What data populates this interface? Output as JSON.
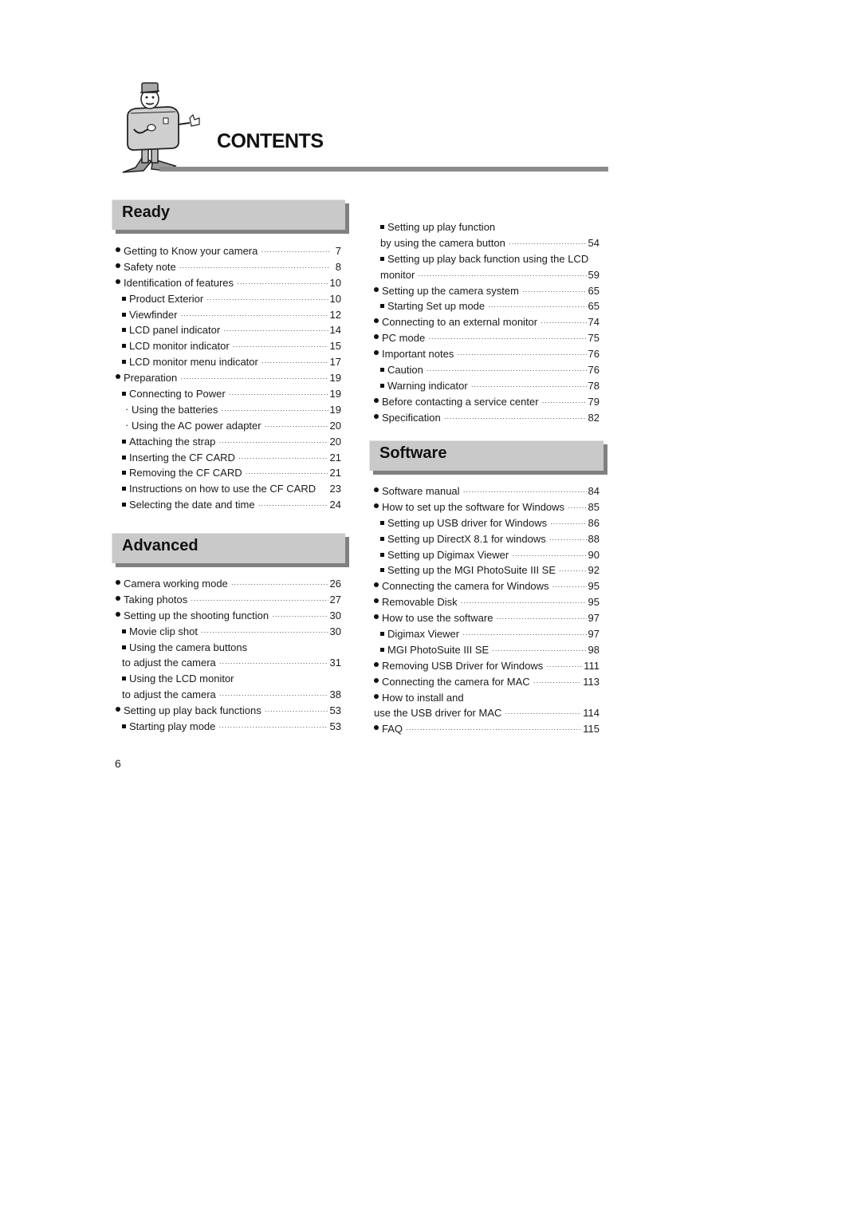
{
  "header": {
    "title": "CONTENTS",
    "mascot_icon": "camera-mascot-icon"
  },
  "sections": {
    "ready": {
      "label": "Ready",
      "items": [
        {
          "level": 0,
          "text": "Getting to Know your camera",
          "page": "7"
        },
        {
          "level": 0,
          "text": "Safety note",
          "page": "8"
        },
        {
          "level": 0,
          "text": "Identification of features",
          "page": "10"
        },
        {
          "level": 1,
          "text": "Product Exterior",
          "page": "10"
        },
        {
          "level": 1,
          "text": "Viewfinder",
          "page": "12"
        },
        {
          "level": 1,
          "text": "LCD panel indicator",
          "page": "14"
        },
        {
          "level": 1,
          "text": "LCD monitor indicator",
          "page": "15"
        },
        {
          "level": 1,
          "text": "LCD monitor menu indicator",
          "page": "17"
        },
        {
          "level": 0,
          "text": "Preparation",
          "page": "19"
        },
        {
          "level": 1,
          "text": "Connecting to Power",
          "page": "19"
        },
        {
          "level": 2,
          "text": "Using the batteries",
          "page": "19"
        },
        {
          "level": 2,
          "text": "Using the AC power adapter",
          "page": "20"
        },
        {
          "level": 1,
          "text": "Attaching the strap",
          "page": "20"
        },
        {
          "level": 1,
          "text": "Inserting the CF CARD",
          "page": "21"
        },
        {
          "level": 1,
          "text": "Removing the CF CARD",
          "page": "21"
        },
        {
          "level": 1,
          "text": "Instructions on how to use the CF CARD",
          "page": "23",
          "nodots": true
        },
        {
          "level": 1,
          "text": "Selecting the date and time",
          "page": "24"
        }
      ]
    },
    "advanced": {
      "label": "Advanced",
      "items": [
        {
          "level": 0,
          "text": "Camera working mode",
          "page": "26"
        },
        {
          "level": 0,
          "text": "Taking photos",
          "page": "27"
        },
        {
          "level": 0,
          "text": "Setting up the shooting function",
          "page": "30"
        },
        {
          "level": 1,
          "text": "Movie clip shot",
          "page": "30"
        },
        {
          "level": 1,
          "text": "Using the camera buttons",
          "page": "",
          "nodots": true
        },
        {
          "level": "cont",
          "text": "to adjust the camera",
          "page": "31"
        },
        {
          "level": 1,
          "text": "Using the LCD monitor",
          "page": "",
          "nodots": true
        },
        {
          "level": "cont",
          "text": "to adjust the camera",
          "page": "38"
        },
        {
          "level": 0,
          "text": "Setting up play back functions",
          "page": "53"
        },
        {
          "level": 1,
          "text": "Starting play mode",
          "page": "53"
        }
      ]
    },
    "ready_continued": {
      "items": [
        {
          "level": 1,
          "text": "Setting up play function",
          "page": "",
          "nodots": true
        },
        {
          "level": "cont",
          "text": "by using the camera button",
          "page": "54"
        },
        {
          "level": 1,
          "text": "Setting up play back function using the LCD",
          "page": "",
          "nodots": true
        },
        {
          "level": "cont",
          "text": "monitor",
          "page": "59"
        },
        {
          "level": 0,
          "text": "Setting up the camera system",
          "page": "65"
        },
        {
          "level": 1,
          "text": "Starting Set up mode",
          "page": "65"
        },
        {
          "level": 0,
          "text": "Connecting to an external monitor",
          "page": "74"
        },
        {
          "level": 0,
          "text": "PC mode",
          "page": "75"
        },
        {
          "level": 0,
          "text": "Important notes",
          "page": "76"
        },
        {
          "level": 1,
          "text": "Caution",
          "page": "76"
        },
        {
          "level": 1,
          "text": "Warning indicator",
          "page": "78"
        },
        {
          "level": 0,
          "text": "Before contacting a service center",
          "page": "79"
        },
        {
          "level": 0,
          "text": "Specification",
          "page": "82"
        }
      ]
    },
    "software": {
      "label": "Software",
      "items": [
        {
          "level": 0,
          "text": "Software manual",
          "page": "84"
        },
        {
          "level": 0,
          "text": "How to set up the software for Windows",
          "page": "85"
        },
        {
          "level": 1,
          "text": "Setting up USB driver for Windows",
          "page": "86"
        },
        {
          "level": 1,
          "text": "Setting up DirectX 8.1 for windows",
          "page": "88"
        },
        {
          "level": 1,
          "text": "Setting up Digimax Viewer",
          "page": "90"
        },
        {
          "level": 1,
          "text": "Setting up the MGI PhotoSuite III SE",
          "page": "92"
        },
        {
          "level": 0,
          "text": "Connecting the camera for Windows",
          "page": "95"
        },
        {
          "level": 0,
          "text": "Removable Disk",
          "page": "95"
        },
        {
          "level": 0,
          "text": "How to use the software",
          "page": "97"
        },
        {
          "level": 1,
          "text": "Digimax Viewer",
          "page": "97"
        },
        {
          "level": 1,
          "text": "MGI PhotoSuite III SE",
          "page": "98"
        },
        {
          "level": 0,
          "text": "Removing USB Driver for Windows",
          "page": "111"
        },
        {
          "level": 0,
          "text": "Connecting the camera for MAC",
          "page": "113"
        },
        {
          "level": 0,
          "text": "How to install and",
          "page": "",
          "nodots": true
        },
        {
          "level": "l0cont",
          "text": "use the USB driver for MAC",
          "page": "114"
        },
        {
          "level": 0,
          "text": "FAQ",
          "page": "115"
        }
      ]
    }
  },
  "footer": {
    "page_number": "6"
  }
}
